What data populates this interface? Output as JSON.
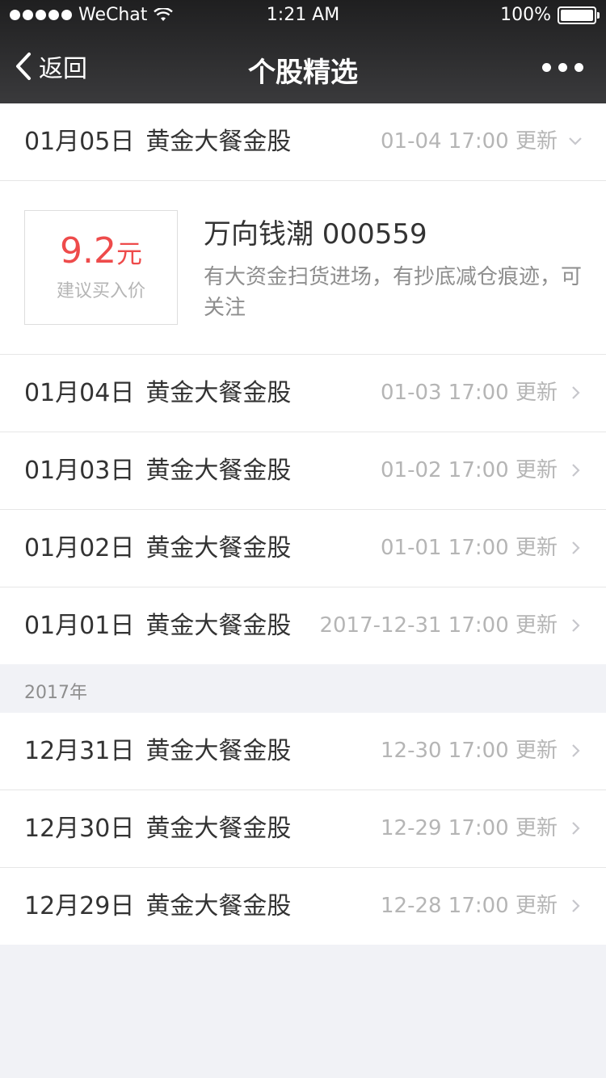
{
  "status_bar": {
    "carrier": "WeChat",
    "time": "1:21 AM",
    "battery": "100%"
  },
  "nav": {
    "back_label": "返回",
    "title": "个股精选"
  },
  "expanded_row": {
    "date": "01月05日",
    "name": "黄金大餐金股",
    "updated": "01-04 17:00 更新"
  },
  "detail": {
    "price_value": "9.2",
    "price_unit": "元",
    "price_label": "建议买入价",
    "stock_name": "万向钱潮 000559",
    "description": "有大资金扫货进场，有抄底减仓痕迹，可关注"
  },
  "rows_2018": [
    {
      "date": "01月04日",
      "name": "黄金大餐金股",
      "updated": "01-03 17:00 更新"
    },
    {
      "date": "01月03日",
      "name": "黄金大餐金股",
      "updated": "01-02 17:00 更新"
    },
    {
      "date": "01月02日",
      "name": "黄金大餐金股",
      "updated": "01-01 17:00 更新"
    },
    {
      "date": "01月01日",
      "name": "黄金大餐金股",
      "updated": "2017-12-31 17:00 更新"
    }
  ],
  "section_2017": {
    "label": "2017年"
  },
  "rows_2017": [
    {
      "date": "12月31日",
      "name": "黄金大餐金股",
      "updated": "12-30 17:00 更新"
    },
    {
      "date": "12月30日",
      "name": "黄金大餐金股",
      "updated": "12-29 17:00 更新"
    },
    {
      "date": "12月29日",
      "name": "黄金大餐金股",
      "updated": "12-28 17:00 更新"
    }
  ]
}
